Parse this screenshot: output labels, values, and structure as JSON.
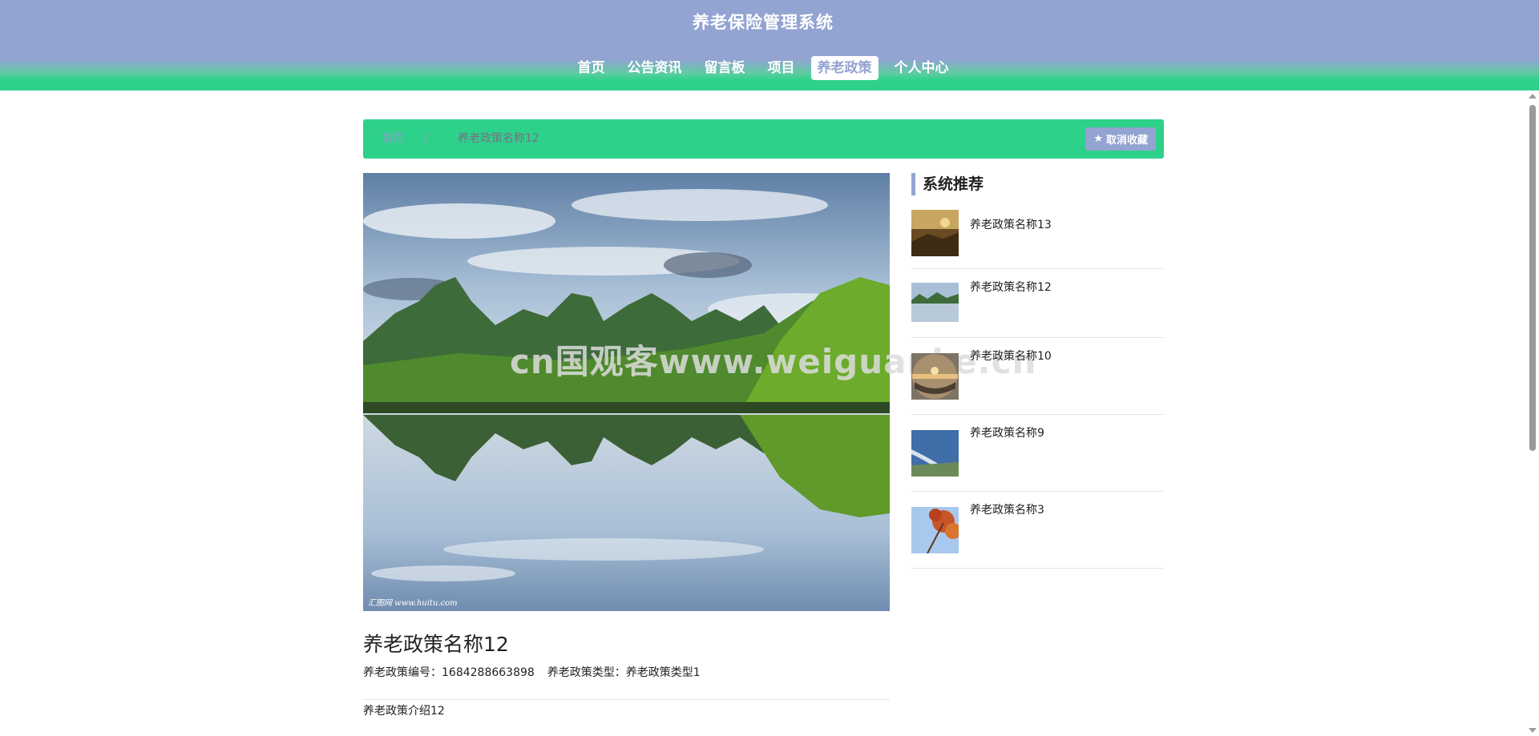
{
  "header": {
    "site_title": "养老保险管理系统",
    "nav": [
      {
        "label": "首页",
        "active": false
      },
      {
        "label": "公告资讯",
        "active": false
      },
      {
        "label": "留言板",
        "active": false
      },
      {
        "label": "项目",
        "active": false
      },
      {
        "label": "养老政策",
        "active": true
      },
      {
        "label": "个人中心",
        "active": false
      }
    ]
  },
  "breadcrumb": {
    "home": "首页",
    "separator": "/",
    "current": "养老政策名称12"
  },
  "favorite_button": {
    "label": "取消收藏",
    "icon": "star-icon"
  },
  "main_image": {
    "caption": "汇图网 www.huitu.com"
  },
  "watermark": "cn国观客www.weiguanke.cn",
  "detail": {
    "title": "养老政策名称12",
    "code_label": "养老政策编号：",
    "code_value": "1684288663898",
    "type_label": "养老政策类型：",
    "type_value": "养老政策类型1",
    "intro": "养老政策介绍12"
  },
  "recommend": {
    "title": "系统推荐",
    "items": [
      {
        "name": "养老政策名称13"
      },
      {
        "name": "养老政策名称12"
      },
      {
        "name": "养老政策名称10"
      },
      {
        "name": "养老政策名称9"
      },
      {
        "name": "养老政策名称3"
      }
    ]
  },
  "colors": {
    "header_top": "#93a3d2",
    "header_bottom": "#2ed18a",
    "accent_green": "#2ed18a",
    "accent_blue": "#93a3d2"
  }
}
